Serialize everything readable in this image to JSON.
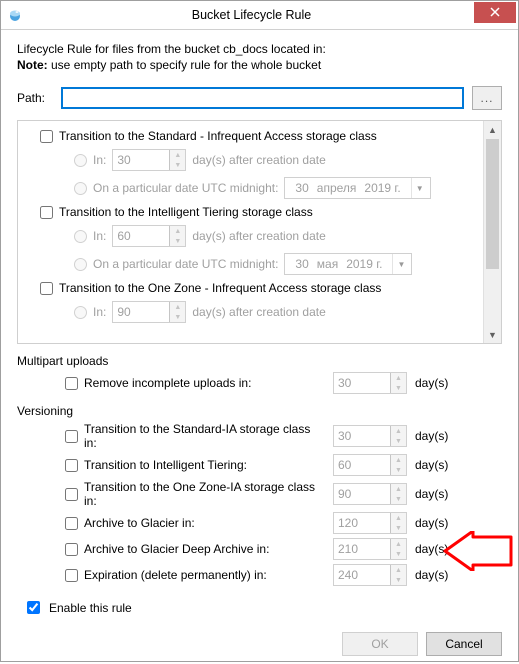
{
  "title": "Bucket Lifecycle Rule",
  "intro": "Lifecycle Rule for files from the bucket cb_docs located in:",
  "note_label": "Note:",
  "note_text": " use empty path to specify rule for the whole bucket",
  "path_label": "Path:",
  "path_value": "",
  "browse_label": "...",
  "transitions": [
    {
      "checkbox": "Transition to the Standard - Infrequent Access storage class",
      "in_label": "In:",
      "in_value": "30",
      "after_label": "day(s) after creation date",
      "date_label": "On a particular date UTC midnight:",
      "date": {
        "day": "30",
        "month": "апреля",
        "year": "2019 г."
      }
    },
    {
      "checkbox": "Transition to the Intelligent Tiering storage class",
      "in_label": "In:",
      "in_value": "60",
      "after_label": "day(s) after creation date",
      "date_label": "On a particular date UTC midnight:",
      "date": {
        "day": "30",
        "month": "мая",
        "year": "2019 г."
      }
    },
    {
      "checkbox": "Transition to the One Zone - Infrequent Access storage class",
      "in_label": "In:",
      "in_value": "90",
      "after_label": "day(s) after creation date",
      "date_label": "",
      "date": null
    }
  ],
  "multipart_title": "Multipart uploads",
  "multipart_option": {
    "label": "Remove incomplete uploads in:",
    "value": "30",
    "unit": "day(s)"
  },
  "versioning_title": "Versioning",
  "versioning_options": [
    {
      "label": "Transition to the Standard-IA storage class in:",
      "value": "30",
      "unit": "day(s)"
    },
    {
      "label": "Transition to Intelligent Tiering:",
      "value": "60",
      "unit": "day(s)"
    },
    {
      "label": "Transition to the One Zone-IA storage class in:",
      "value": "90",
      "unit": "day(s)"
    },
    {
      "label": "Archive to Glacier in:",
      "value": "120",
      "unit": "day(s)"
    },
    {
      "label": "Archive to Glacier Deep Archive in:",
      "value": "210",
      "unit": "day(s)"
    },
    {
      "label": "Expiration (delete permanently) in:",
      "value": "240",
      "unit": "day(s)"
    }
  ],
  "enable_label": "Enable this rule",
  "enable_checked": true,
  "ok_label": "OK",
  "cancel_label": "Cancel"
}
